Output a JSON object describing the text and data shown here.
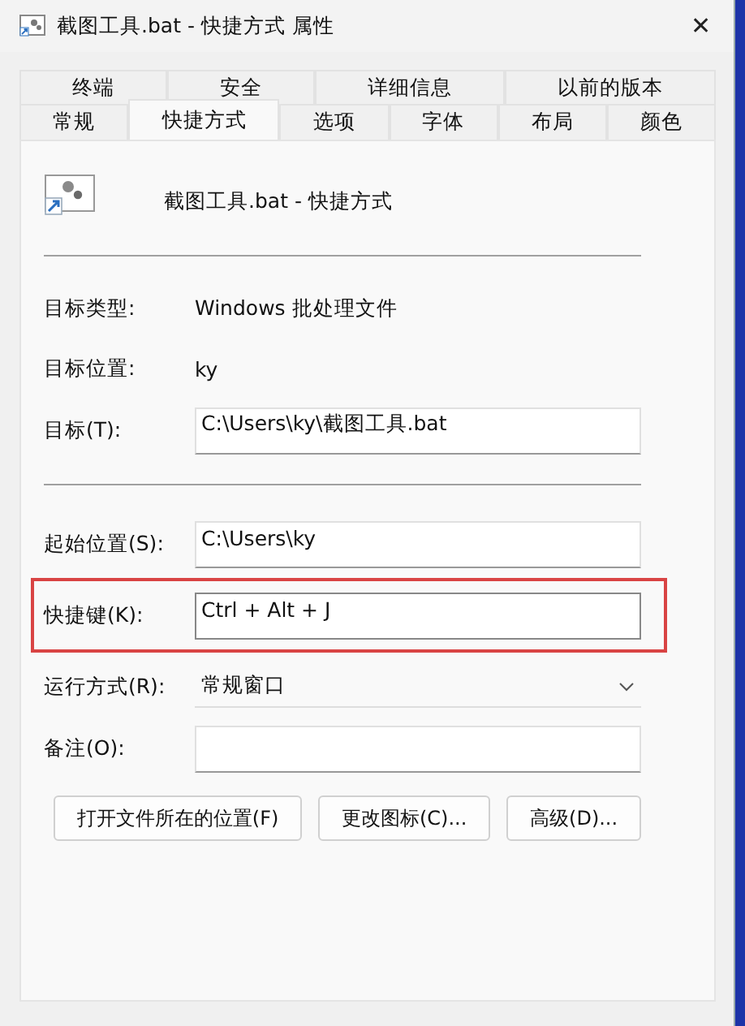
{
  "window": {
    "title": "截图工具.bat - 快捷方式 属性",
    "close": "✕"
  },
  "tab_rows": [
    [
      {
        "label": "终端",
        "selected": false
      },
      {
        "label": "安全",
        "selected": false
      },
      {
        "label": "详细信息",
        "selected": false
      },
      {
        "label": "以前的版本",
        "selected": false
      }
    ],
    [
      {
        "label": "常规",
        "selected": false
      },
      {
        "label": "快捷方式",
        "selected": true
      },
      {
        "label": "选项",
        "selected": false
      },
      {
        "label": "字体",
        "selected": false
      },
      {
        "label": "布局",
        "selected": false
      },
      {
        "label": "颜色",
        "selected": false
      }
    ]
  ],
  "shortcut": {
    "name": "截图工具.bat - 快捷方式"
  },
  "info": [
    {
      "label": "目标类型:",
      "value": "Windows 批处理文件"
    },
    {
      "label": "目标位置:",
      "value": "ky"
    }
  ],
  "target": {
    "label": "目标(T):",
    "value": "C:\\Users\\ky\\截图工具.bat"
  },
  "fields": [
    {
      "kind": "text",
      "label": "起始位置(S):",
      "value": "C:\\Users\\ky",
      "highlighted": false
    },
    {
      "kind": "text",
      "label": "快捷键(K):",
      "value": "Ctrl + Alt + J",
      "highlighted": true
    },
    {
      "kind": "dropdown",
      "label": "运行方式(R):",
      "value": "常规窗口",
      "highlighted": false
    },
    {
      "kind": "text",
      "label": "备注(O):",
      "highlighted": false
    }
  ],
  "buttons": [
    "打开文件所在的位置(F)",
    "更改图标(C)...",
    "高级(D)..."
  ]
}
